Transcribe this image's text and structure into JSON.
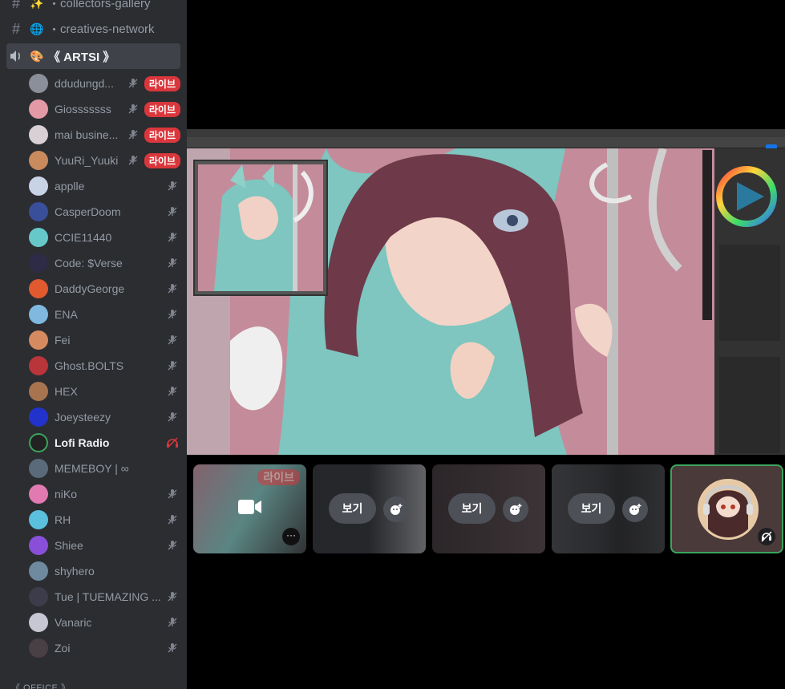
{
  "channels": [
    {
      "name": "collectors-gallery",
      "emoji": "✨",
      "prefix": "・"
    },
    {
      "name": "creatives-network",
      "emoji": "🌐",
      "prefix": "・"
    }
  ],
  "voice_channel": {
    "name": "《 ARTSI 》",
    "emoji": "🎨"
  },
  "users": [
    {
      "name": "ddudungd...",
      "live": "라이브",
      "avatar_color": "#8a8f99",
      "active": false
    },
    {
      "name": "Giosssssss",
      "live": "라이브",
      "avatar_color": "#e49aa6",
      "active": false
    },
    {
      "name": "mai busine...",
      "live": "라이브",
      "avatar_color": "#d8d0d4",
      "active": false
    },
    {
      "name": "YuuRi_Yuuki",
      "live": "라이브",
      "avatar_color": "#c98a5e",
      "active": false
    },
    {
      "name": "applle",
      "live": "",
      "avatar_color": "#c9d3e6",
      "active": false
    },
    {
      "name": "CasperDoom",
      "live": "",
      "avatar_color": "#3a4f9a",
      "active": false
    },
    {
      "name": "CCIE11440",
      "live": "",
      "avatar_color": "#67c8c9",
      "active": false
    },
    {
      "name": "Code: $Verse",
      "live": "",
      "avatar_color": "#2d2b45",
      "active": false
    },
    {
      "name": "DaddyGeorge",
      "live": "",
      "avatar_color": "#e0592f",
      "active": false
    },
    {
      "name": "ENA",
      "live": "",
      "avatar_color": "#7fb9e0",
      "active": false
    },
    {
      "name": "Fei",
      "live": "",
      "avatar_color": "#d58b5f",
      "active": false
    },
    {
      "name": "Ghost.BOLTS",
      "live": "",
      "avatar_color": "#b8353a",
      "active": false
    },
    {
      "name": "HEX",
      "live": "",
      "avatar_color": "#a87450",
      "active": false
    },
    {
      "name": "Joeysteezy",
      "live": "",
      "avatar_color": "#2233cc",
      "active": false
    },
    {
      "name": "Lofi Radio",
      "live": "",
      "avatar_color": "#3ba55d",
      "active": true
    },
    {
      "name": "MEMEBOY | ∞",
      "live": "",
      "avatar_color": "#5b6a7a",
      "active": false
    },
    {
      "name": "niKo",
      "live": "",
      "avatar_color": "#e07ab0",
      "active": false
    },
    {
      "name": "RH",
      "live": "",
      "avatar_color": "#5bc0de",
      "active": false
    },
    {
      "name": "Shiee",
      "live": "",
      "avatar_color": "#8a4fd8",
      "active": false
    },
    {
      "name": "shyhero",
      "live": "",
      "avatar_color": "#6f8a9e",
      "active": false
    },
    {
      "name": "Tue | TUEMAZING ...",
      "live": "",
      "avatar_color": "#3c3c4a",
      "active": false
    },
    {
      "name": "Vanaric",
      "live": "",
      "avatar_color": "#c7c7d4",
      "active": false
    },
    {
      "name": "Zoi",
      "live": "",
      "avatar_color": "#4a3f45",
      "active": false
    }
  ],
  "category": "《 OFFICE 》",
  "thumbs": {
    "live_label": "라이브",
    "view_label": "보기",
    "more": "···"
  },
  "colors": {
    "live_red": "#da373c",
    "speaking_green": "#3ba55d",
    "sidebar_bg": "#2b2d31"
  }
}
